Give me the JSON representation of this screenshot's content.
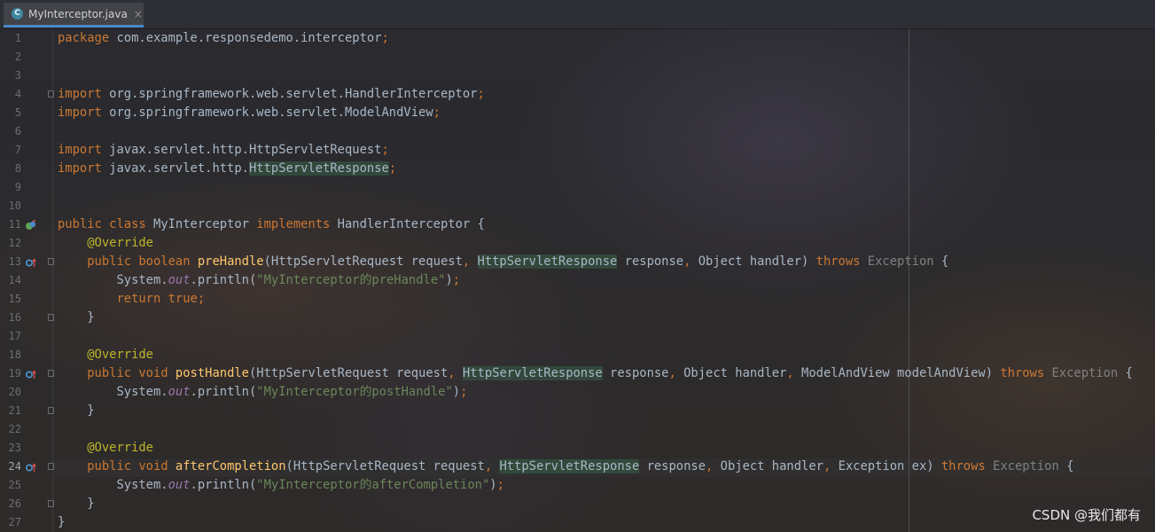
{
  "tab": {
    "filename": "MyInterceptor.java",
    "icon": "class-icon",
    "icon_letter": "C",
    "close_label": "×"
  },
  "editor": {
    "current_line": 24
  },
  "lines": [
    [
      [
        "kw",
        "package"
      ],
      [
        "t",
        " com.example.responsedemo.interceptor"
      ],
      [
        "kw",
        ";"
      ]
    ],
    [],
    [],
    [
      [
        "kw",
        "import"
      ],
      [
        "t",
        " org.springframework.web.servlet.HandlerInterceptor"
      ],
      [
        "kw",
        ";"
      ]
    ],
    [
      [
        "kw",
        "import"
      ],
      [
        "t",
        " org.springframework.web.servlet.ModelAndView"
      ],
      [
        "kw",
        ";"
      ]
    ],
    [],
    [
      [
        "kw",
        "import"
      ],
      [
        "t",
        " javax.servlet.http.HttpServletRequest"
      ],
      [
        "kw",
        ";"
      ]
    ],
    [
      [
        "kw",
        "import"
      ],
      [
        "t",
        " javax.servlet.http."
      ],
      [
        "hl",
        "HttpServletResponse"
      ],
      [
        "kw",
        ";"
      ]
    ],
    [],
    [],
    [
      [
        "kw",
        "public class"
      ],
      [
        "t",
        " MyInterceptor "
      ],
      [
        "kw",
        "implements"
      ],
      [
        "t",
        " HandlerInterceptor {"
      ]
    ],
    [
      [
        "t",
        "    "
      ],
      [
        "ann",
        "@Override"
      ]
    ],
    [
      [
        "t",
        "    "
      ],
      [
        "kw",
        "public boolean"
      ],
      [
        "t",
        " "
      ],
      [
        "fn",
        "preHandle"
      ],
      [
        "t",
        "(HttpServletRequest request"
      ],
      [
        "kw",
        ","
      ],
      [
        "t",
        " "
      ],
      [
        "hl",
        "HttpServletResponse"
      ],
      [
        "t",
        " response"
      ],
      [
        "kw",
        ","
      ],
      [
        "t",
        " Object handler) "
      ],
      [
        "kw",
        "throws"
      ],
      [
        "t",
        " "
      ],
      [
        "dim",
        "Exception"
      ],
      [
        "t",
        " {"
      ]
    ],
    [
      [
        "t",
        "        System."
      ],
      [
        "st",
        "out"
      ],
      [
        "t",
        ".println("
      ],
      [
        "str",
        "\"MyInterceptor的preHandle\""
      ],
      [
        "t",
        ")"
      ],
      [
        "kw",
        ";"
      ]
    ],
    [
      [
        "t",
        "        "
      ],
      [
        "kw",
        "return true;"
      ]
    ],
    [
      [
        "t",
        "    }"
      ]
    ],
    [],
    [
      [
        "t",
        "    "
      ],
      [
        "ann",
        "@Override"
      ]
    ],
    [
      [
        "t",
        "    "
      ],
      [
        "kw",
        "public void"
      ],
      [
        "t",
        " "
      ],
      [
        "fn",
        "postHandle"
      ],
      [
        "t",
        "(HttpServletRequest request"
      ],
      [
        "kw",
        ","
      ],
      [
        "t",
        " "
      ],
      [
        "hl",
        "HttpServletResponse"
      ],
      [
        "t",
        " response"
      ],
      [
        "kw",
        ","
      ],
      [
        "t",
        " Object handler"
      ],
      [
        "kw",
        ","
      ],
      [
        "t",
        " ModelAndView modelAndView) "
      ],
      [
        "kw",
        "throws"
      ],
      [
        "t",
        " "
      ],
      [
        "dim",
        "Exception"
      ],
      [
        "t",
        " {"
      ]
    ],
    [
      [
        "t",
        "        System."
      ],
      [
        "st",
        "out"
      ],
      [
        "t",
        ".println("
      ],
      [
        "str",
        "\"MyInterceptor的postHandle\""
      ],
      [
        "t",
        ")"
      ],
      [
        "kw",
        ";"
      ]
    ],
    [
      [
        "t",
        "    }"
      ]
    ],
    [],
    [
      [
        "t",
        "    "
      ],
      [
        "ann",
        "@Override"
      ]
    ],
    [
      [
        "t",
        "    "
      ],
      [
        "kw",
        "public void"
      ],
      [
        "t",
        " "
      ],
      [
        "fn",
        "afterCompletion"
      ],
      [
        "t",
        "(HttpServletRequest request"
      ],
      [
        "kw",
        ","
      ],
      [
        "t",
        " "
      ],
      [
        "hl",
        "HttpServletResponse"
      ],
      [
        "t",
        " response"
      ],
      [
        "kw",
        ","
      ],
      [
        "t",
        " Object handler"
      ],
      [
        "kw",
        ","
      ],
      [
        "t",
        " Exception ex) "
      ],
      [
        "kw",
        "throws"
      ],
      [
        "t",
        " "
      ],
      [
        "dim",
        "Exception"
      ],
      [
        "t",
        " {"
      ]
    ],
    [
      [
        "t",
        "        System."
      ],
      [
        "st",
        "out"
      ],
      [
        "t",
        ".println("
      ],
      [
        "str",
        "\"MyInterceptor的afterCompletion\""
      ],
      [
        "t",
        ")"
      ],
      [
        "kw",
        ";"
      ]
    ],
    [
      [
        "t",
        "    }"
      ]
    ],
    [
      [
        "t",
        "}"
      ]
    ]
  ],
  "gutter_icons": [
    {
      "line": 11,
      "icon": "implemented-interface-icon"
    },
    {
      "line": 13,
      "icon": "override-method-icon"
    },
    {
      "line": 19,
      "icon": "override-method-icon"
    },
    {
      "line": 24,
      "icon": "override-method-icon"
    }
  ],
  "fold_markers": [
    4,
    13,
    16,
    19,
    21,
    24,
    26
  ],
  "watermark": "CSDN @我们都有"
}
